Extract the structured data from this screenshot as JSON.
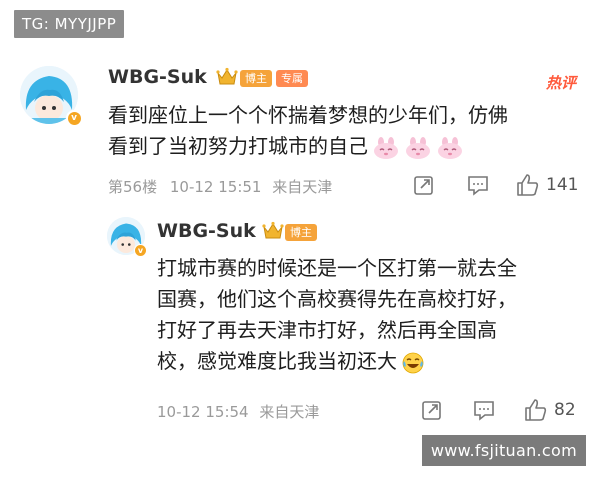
{
  "overlay": {
    "top_tag": "TG: MYYJJPP",
    "watermark": "www.fsjituan.com"
  },
  "comment": {
    "username": "WBG-Suk",
    "badge_bozhu": "博主",
    "badge_zhuanshu": "专属",
    "hot_label": "热评",
    "text_line1": "看到座位上一个个怀揣着梦想的少年们，仿佛",
    "text_line2": "看到了当初努力打城市的自己",
    "emoji": [
      "pink-bunny",
      "pink-bunny",
      "pink-bunny"
    ],
    "floor": "第56楼",
    "date": "10-12 15:51",
    "location": "来自天津",
    "likes": "141"
  },
  "reply": {
    "username": "WBG-Suk",
    "badge_bozhu": "博主",
    "text_line1": "打城市赛的时候还是一个区打第一就去全",
    "text_line2": "国赛，他们这个高校赛得先在高校打好，",
    "text_line3": "打好了再去天津市打好，然后再全国高",
    "text_line4": "校，感觉难度比我当初还大",
    "emoji": "laughing-tears",
    "date": "10-12 15:54",
    "location": "来自天津",
    "likes": "82"
  },
  "colors": {
    "accent_orange": "#f5a623",
    "hot_red": "#ff5a3c",
    "meta_gray": "#9a9a9a"
  },
  "icons": [
    "share-icon",
    "comment-icon",
    "like-icon"
  ]
}
